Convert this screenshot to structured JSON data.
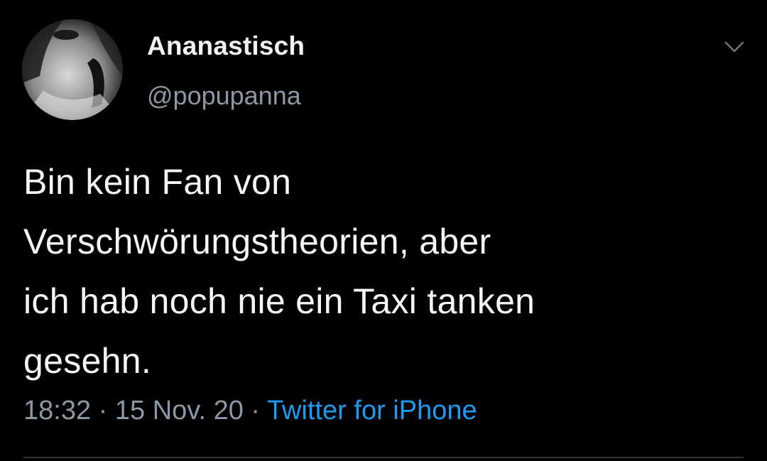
{
  "user": {
    "display_name": "Ananastisch",
    "handle": "@popupanna"
  },
  "tweet": {
    "lines": [
      "Bin kein Fan von",
      "Verschwörungstheorien, aber",
      "ich hab noch nie ein Taxi tanken",
      "gesehn."
    ],
    "time": "18:32",
    "separator": " · ",
    "date": "15 Nov. 20",
    "source": "Twitter for iPhone"
  },
  "icons": {
    "more": "chevron-down-icon",
    "avatar": "avatar"
  },
  "colors": {
    "background": "#000000",
    "text": "#f5f5f5",
    "muted": "#8b98a5",
    "link": "#1d9bf0"
  }
}
